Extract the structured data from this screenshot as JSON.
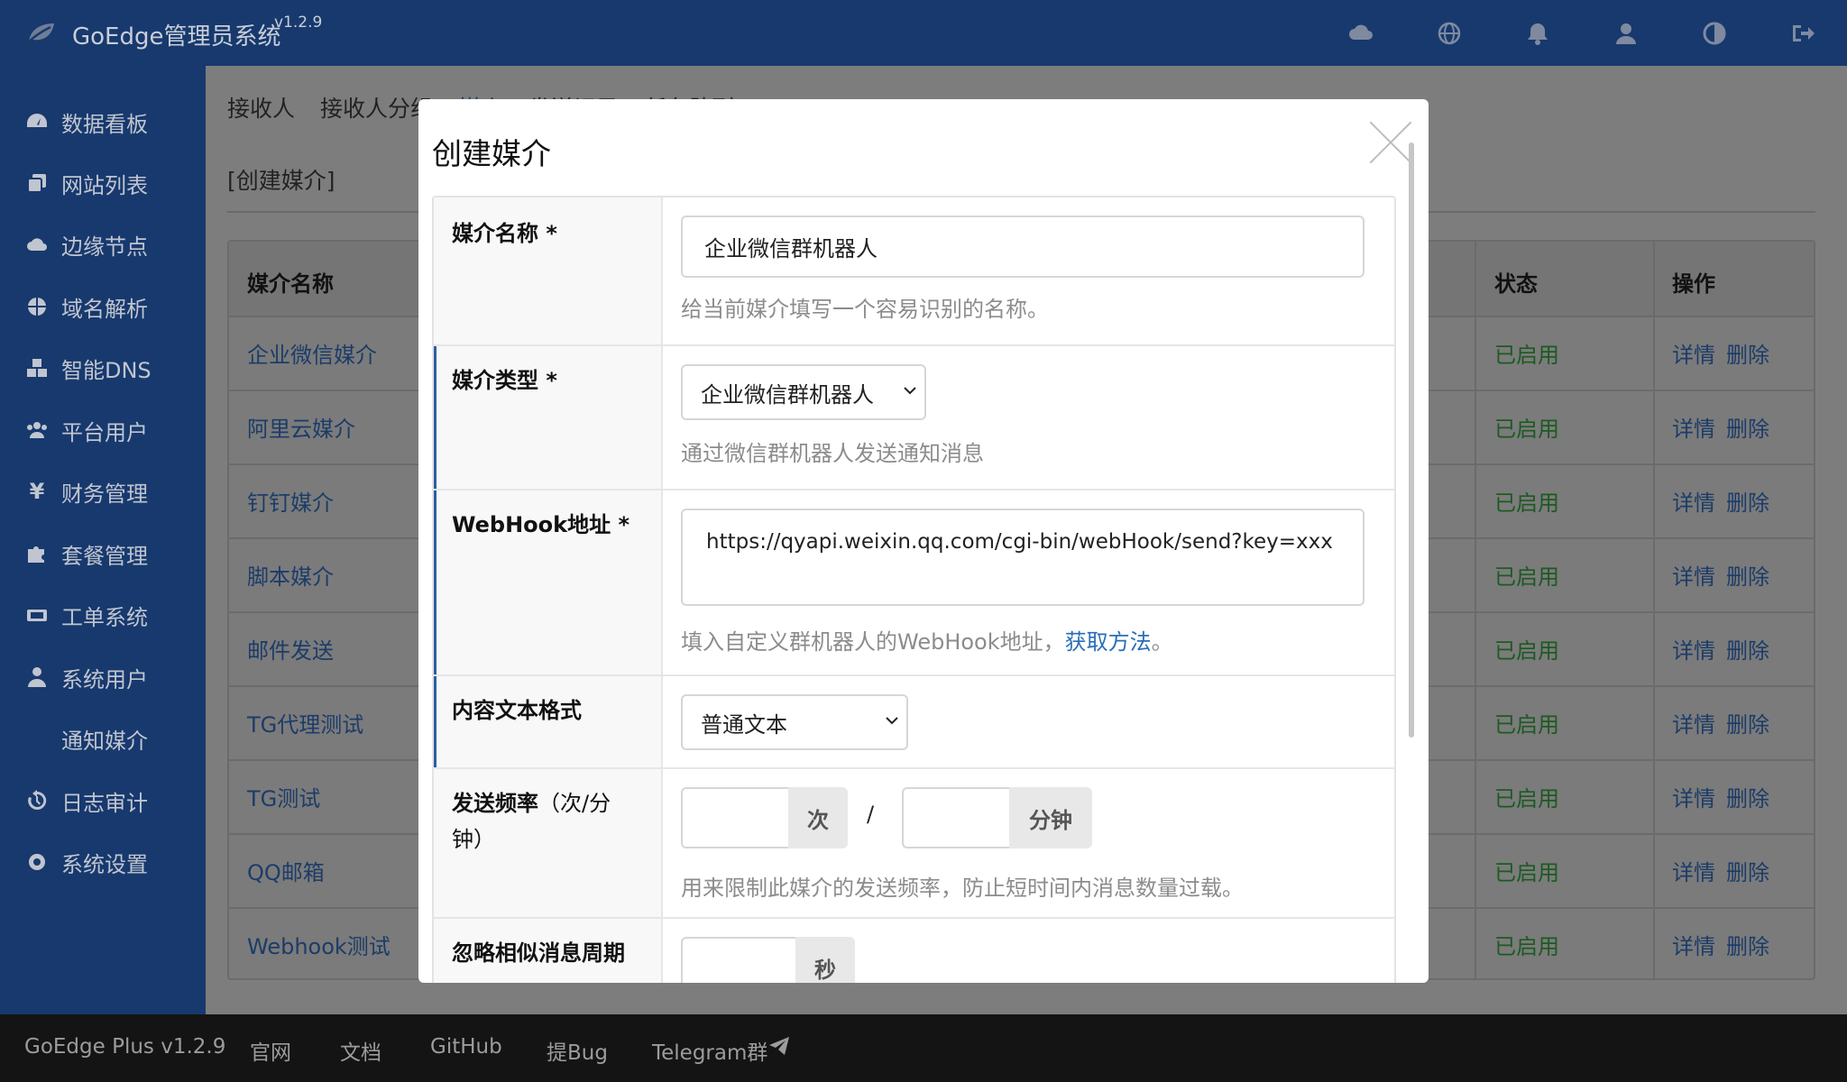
{
  "header": {
    "app_title": "GoEdge管理员系统",
    "version": "v1.2.9",
    "icons": [
      "cloud-icon",
      "globe-icon",
      "bell-icon",
      "user-icon",
      "contrast-icon",
      "logout-icon"
    ]
  },
  "sidebar": {
    "items": [
      {
        "label": "数据看板",
        "icon": "dashboard-icon"
      },
      {
        "label": "网站列表",
        "icon": "stack-icon"
      },
      {
        "label": "边缘节点",
        "icon": "cloud-icon"
      },
      {
        "label": "域名解析",
        "icon": "globe-icon"
      },
      {
        "label": "智能DNS",
        "icon": "cubes-icon"
      },
      {
        "label": "平台用户",
        "icon": "users-icon"
      },
      {
        "label": "财务管理",
        "icon": "yen-icon"
      },
      {
        "label": "套餐管理",
        "icon": "puzzle-icon"
      },
      {
        "label": "工单系统",
        "icon": "ticket-icon"
      },
      {
        "label": "系统用户",
        "icon": "user-tie-icon"
      },
      {
        "label": "通知媒介",
        "icon": ""
      },
      {
        "label": "日志审计",
        "icon": "history-icon"
      },
      {
        "label": "系统设置",
        "icon": "gear-icon"
      }
    ]
  },
  "main": {
    "tabs": [
      "接收人",
      "接收人分组",
      "媒介",
      "发送记录",
      "任务队列"
    ],
    "breadcrumb": "[创建媒介]",
    "table": {
      "headers": {
        "name": "媒介名称",
        "status": "状态",
        "ops": "操作"
      },
      "rows": [
        {
          "name": "企业微信媒介",
          "status": "已启用",
          "detail": "详情",
          "delete": "删除"
        },
        {
          "name": "阿里云媒介",
          "status": "已启用",
          "detail": "详情",
          "delete": "删除"
        },
        {
          "name": "钉钉媒介",
          "status": "已启用",
          "detail": "详情",
          "delete": "删除"
        },
        {
          "name": "脚本媒介",
          "status": "已启用",
          "detail": "详情",
          "delete": "删除"
        },
        {
          "name": "邮件发送",
          "status": "已启用",
          "detail": "详情",
          "delete": "删除"
        },
        {
          "name": "TG代理测试",
          "status": "已启用",
          "detail": "详情",
          "delete": "删除"
        },
        {
          "name": "TG测试",
          "status": "已启用",
          "detail": "详情",
          "delete": "删除"
        },
        {
          "name": "QQ邮箱",
          "status": "已启用",
          "detail": "详情",
          "delete": "删除"
        },
        {
          "name": "Webhook测试",
          "status": "已启用",
          "detail": "详情",
          "delete": "删除"
        }
      ]
    }
  },
  "modal": {
    "title": "创建媒介",
    "fields": {
      "name": {
        "label": "媒介名称",
        "required": "*",
        "value": "企业微信群机器人",
        "hint": "给当前媒介填写一个容易识别的名称。"
      },
      "type": {
        "label": "媒介类型",
        "required": "*",
        "value": "企业微信群机器人",
        "hint": "通过微信群机器人发送通知消息"
      },
      "webhook": {
        "label": "WebHook地址",
        "required": "*",
        "value": "https://qyapi.weixin.qq.com/cgi-bin/webHook/send?key=xxx",
        "hint_before": "填入自定义群机器人的WebHook地址，",
        "hint_link": "获取方法",
        "hint_after": "。"
      },
      "format": {
        "label": "内容文本格式",
        "value": "普通文本"
      },
      "rate": {
        "label": "发送频率",
        "sublabel": "（次/分钟）",
        "count_unit": "次",
        "separator": "/",
        "minute_unit": "分钟",
        "hint": "用来限制此媒介的发送频率，防止短时间内消息数量过载。"
      },
      "ignore": {
        "label": "忽略相似消息周期",
        "unit": "秒"
      }
    }
  },
  "footer": {
    "version": "GoEdge Plus v1.2.9",
    "links": [
      "官网",
      "文档",
      "GitHub",
      "提Bug",
      "Telegram群"
    ]
  }
}
